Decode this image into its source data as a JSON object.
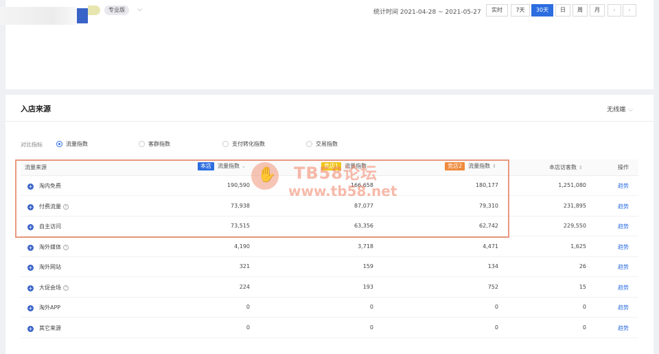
{
  "header": {
    "edition": "专业版",
    "stat_time": "统计时间 2021-04-28 ~ 2021-05-27",
    "periods": [
      "实时",
      "7天",
      "30天",
      "日",
      "周",
      "月"
    ],
    "active_period": "30天",
    "prev": "‹",
    "next": "›"
  },
  "section": {
    "title": "入店来源",
    "device": "无线端"
  },
  "compare": {
    "label": "对比指标",
    "options": [
      "流量指数",
      "客群指数",
      "支付转化指数",
      "交易指数"
    ],
    "selected": "流量指数"
  },
  "table": {
    "headers": {
      "source": "流量来源",
      "own_tag": "本店",
      "own_metric": "流量指数",
      "comp1_tag": "竞店1",
      "comp1_metric": "流量指数",
      "comp2_tag": "竞店2",
      "comp2_metric": "流量指数",
      "visitors": "本店访客数",
      "op": "操作"
    },
    "tag_colors": {
      "own": "#2c6de0",
      "comp1": "#f0c419",
      "comp2": "#f08a3c"
    },
    "rows": [
      {
        "source": "淘内免费",
        "help": false,
        "own": "190,590",
        "comp1": "166,658",
        "comp2": "180,177",
        "visitors": "1,251,080",
        "op": "趋势"
      },
      {
        "source": "付费流量",
        "help": true,
        "own": "73,938",
        "comp1": "87,077",
        "comp2": "79,310",
        "visitors": "231,895",
        "op": "趋势"
      },
      {
        "source": "自主访问",
        "help": false,
        "own": "73,515",
        "comp1": "63,356",
        "comp2": "62,742",
        "visitors": "229,550",
        "op": "趋势"
      },
      {
        "source": "淘外媒体",
        "help": true,
        "own": "4,190",
        "comp1": "3,718",
        "comp2": "4,471",
        "visitors": "1,625",
        "op": "趋势"
      },
      {
        "source": "淘外网站",
        "help": false,
        "own": "321",
        "comp1": "159",
        "comp2": "134",
        "visitors": "26",
        "op": "趋势"
      },
      {
        "source": "大促会场",
        "help": true,
        "own": "224",
        "comp1": "193",
        "comp2": "752",
        "visitors": "15",
        "op": "趋势"
      },
      {
        "source": "淘外APP",
        "help": false,
        "own": "0",
        "comp1": "0",
        "comp2": "0",
        "visitors": "0",
        "op": "趋势"
      },
      {
        "source": "其它来源",
        "help": false,
        "own": "0",
        "comp1": "0",
        "comp2": "0",
        "visitors": "0",
        "op": "趋势"
      }
    ]
  },
  "watermark": {
    "line1": "TB58论坛",
    "line2": "www.tb58.net"
  }
}
